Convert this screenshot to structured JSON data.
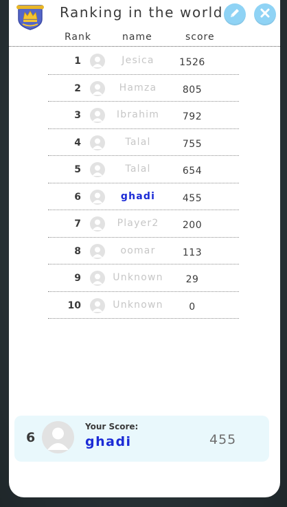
{
  "header": {
    "title": "Ranking in the world",
    "logo_icon": "crown-shield-icon",
    "edit_icon": "pencil-icon",
    "close_icon": "close-icon",
    "accent_color": "#8fd3f5"
  },
  "columns": {
    "rank": "Rank",
    "name": "name",
    "score": "score"
  },
  "rows": [
    {
      "rank": "1",
      "name": "Jesica",
      "score": "1526"
    },
    {
      "rank": "2",
      "name": "Hamza",
      "score": "805"
    },
    {
      "rank": "3",
      "name": "Ibrahim",
      "score": "792"
    },
    {
      "rank": "4",
      "name": "Talal",
      "score": "755"
    },
    {
      "rank": "5",
      "name": "Talal",
      "score": "654"
    },
    {
      "rank": "6",
      "name": "ghadi",
      "score": "455",
      "highlight": true
    },
    {
      "rank": "7",
      "name": "Player2",
      "score": "200"
    },
    {
      "rank": "8",
      "name": "oomar",
      "score": "113"
    },
    {
      "rank": "9",
      "name": "Unknown",
      "score": "29"
    },
    {
      "rank": "10",
      "name": "Unknown",
      "score": "0"
    }
  ],
  "your_score": {
    "rank": "6",
    "label": "Your Score:",
    "name": "ghadi",
    "score": "455",
    "avatar_icon": "user-avatar-icon"
  }
}
